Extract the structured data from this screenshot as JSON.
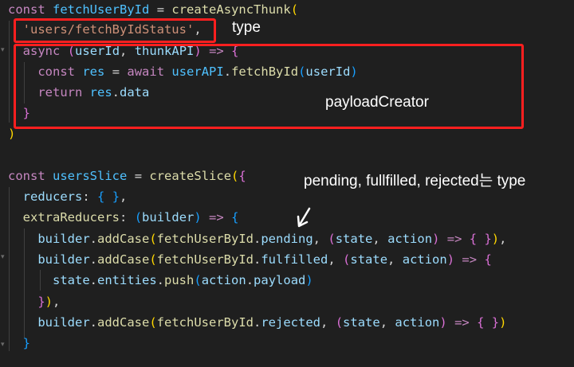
{
  "annotations": {
    "type_label": "type",
    "payload_label": "payloadCreator",
    "note_label": "pending, fullfilled, rejected는 type"
  },
  "code": {
    "l1": {
      "kw": "const",
      "name": "fetchUserById",
      "eq": "=",
      "fn": "createAsyncThunk",
      "paren": "("
    },
    "l2": {
      "str": "'users/fetchByIdStatus'",
      "comma": ","
    },
    "l3": {
      "kw": "async",
      "p1": "(",
      "a1": "userId",
      "c": ",",
      "a2": "thunkAPI",
      "p2": ")",
      "arrow": "=>",
      "brace": "{"
    },
    "l4": {
      "kw": "const",
      "v": "res",
      "eq": "=",
      "aw": "await",
      "obj": "userAPI",
      "dot": ".",
      "fn": "fetchById",
      "p1": "(",
      "arg": "userId",
      "p2": ")"
    },
    "l5": {
      "kw": "return",
      "obj": "res",
      "dot": ".",
      "prop": "data"
    },
    "l6": {
      "brace": "}"
    },
    "l7": {
      "paren": ")"
    },
    "l8": {
      "kw": "const",
      "name": "usersSlice",
      "eq": "=",
      "fn": "createSlice",
      "p": "(",
      "b": "{"
    },
    "l9": {
      "key": "reducers",
      "colon": ":",
      "b1": "{",
      "b2": "}",
      "comma": ","
    },
    "l10": {
      "key": "extraReducers",
      "colon": ":",
      "p1": "(",
      "arg": "builder",
      "p2": ")",
      "arrow": "=>",
      "b": "{"
    },
    "l11": {
      "obj": "builder",
      "dot": ".",
      "fn": "addCase",
      "p1": "(",
      "t": "fetchUserById",
      "dot2": ".",
      "prop": "pending",
      "c": ",",
      "p2": "(",
      "a1": "state",
      "c2": ",",
      "a2": "action",
      "p3": ")",
      "arrow": "=>",
      "b1": "{",
      "b2": "}",
      "p4": ")",
      "semi": ","
    },
    "l12": {
      "obj": "builder",
      "dot": ".",
      "fn": "addCase",
      "p1": "(",
      "t": "fetchUserById",
      "dot2": ".",
      "prop": "fulfilled",
      "c": ",",
      "p2": "(",
      "a1": "state",
      "c2": ",",
      "a2": "action",
      "p3": ")",
      "arrow": "=>",
      "b1": "{"
    },
    "l13": {
      "obj": "state",
      "dot": ".",
      "prop": "entities",
      "dot2": ".",
      "fn": "push",
      "p1": "(",
      "arg": "action",
      "dot3": ".",
      "prop2": "payload",
      "p2": ")"
    },
    "l14": {
      "b": "}",
      "p": ")",
      "comma": ","
    },
    "l15": {
      "obj": "builder",
      "dot": ".",
      "fn": "addCase",
      "p1": "(",
      "t": "fetchUserById",
      "dot2": ".",
      "prop": "rejected",
      "c": ",",
      "p2": "(",
      "a1": "state",
      "c2": ",",
      "a2": "action",
      "p3": ")",
      "arrow": "=>",
      "b1": "{",
      "b2": "}",
      "p4": ")"
    },
    "l16": {
      "b": "}"
    }
  },
  "colors": {
    "annotation_box": "#ff1f1f",
    "editor_bg": "#1f1f1f"
  }
}
